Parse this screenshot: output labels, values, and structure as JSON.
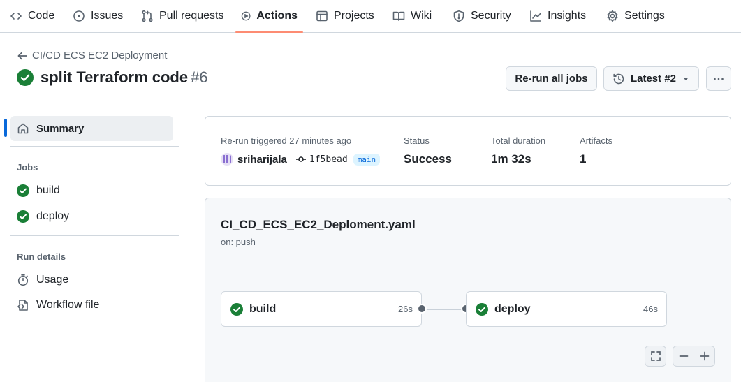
{
  "nav": {
    "tabs": [
      {
        "label": "Code",
        "icon": "code-icon"
      },
      {
        "label": "Issues",
        "icon": "issue-icon"
      },
      {
        "label": "Pull requests",
        "icon": "pull-request-icon"
      },
      {
        "label": "Actions",
        "icon": "play-icon",
        "active": true
      },
      {
        "label": "Projects",
        "icon": "table-icon"
      },
      {
        "label": "Wiki",
        "icon": "book-icon"
      },
      {
        "label": "Security",
        "icon": "shield-icon"
      },
      {
        "label": "Insights",
        "icon": "graph-icon"
      },
      {
        "label": "Settings",
        "icon": "gear-icon"
      }
    ]
  },
  "header": {
    "back_label": "CI/CD ECS EC2 Deployment",
    "run_title": "split Terraform code",
    "run_number": "#6",
    "rerun_button": "Re-run all jobs",
    "attempt_button": "Latest #2"
  },
  "sidebar": {
    "summary_label": "Summary",
    "jobs_heading": "Jobs",
    "jobs": [
      {
        "label": "build",
        "status": "success"
      },
      {
        "label": "deploy",
        "status": "success"
      }
    ],
    "run_details_heading": "Run details",
    "details": [
      {
        "label": "Usage",
        "icon": "stopwatch-icon"
      },
      {
        "label": "Workflow file",
        "icon": "file-code-icon"
      }
    ]
  },
  "summary": {
    "trigger_text": "Re-run triggered 27 minutes ago",
    "actor": "sriharijala",
    "commit_sha": "1f5bead",
    "branch": "main",
    "status_label": "Status",
    "status_value": "Success",
    "duration_label": "Total duration",
    "duration_value": "1m 32s",
    "artifacts_label": "Artifacts",
    "artifacts_value": "1"
  },
  "workflow": {
    "file_name": "CI_CD_ECS_EC2_Deploment.yaml",
    "trigger": "on: push",
    "jobs": [
      {
        "name": "build",
        "duration": "26s",
        "status": "success"
      },
      {
        "name": "deploy",
        "duration": "46s",
        "status": "success"
      }
    ]
  },
  "colors": {
    "success": "#1a7f37",
    "accent_underline": "#fd8c73",
    "link": "#0969da"
  }
}
